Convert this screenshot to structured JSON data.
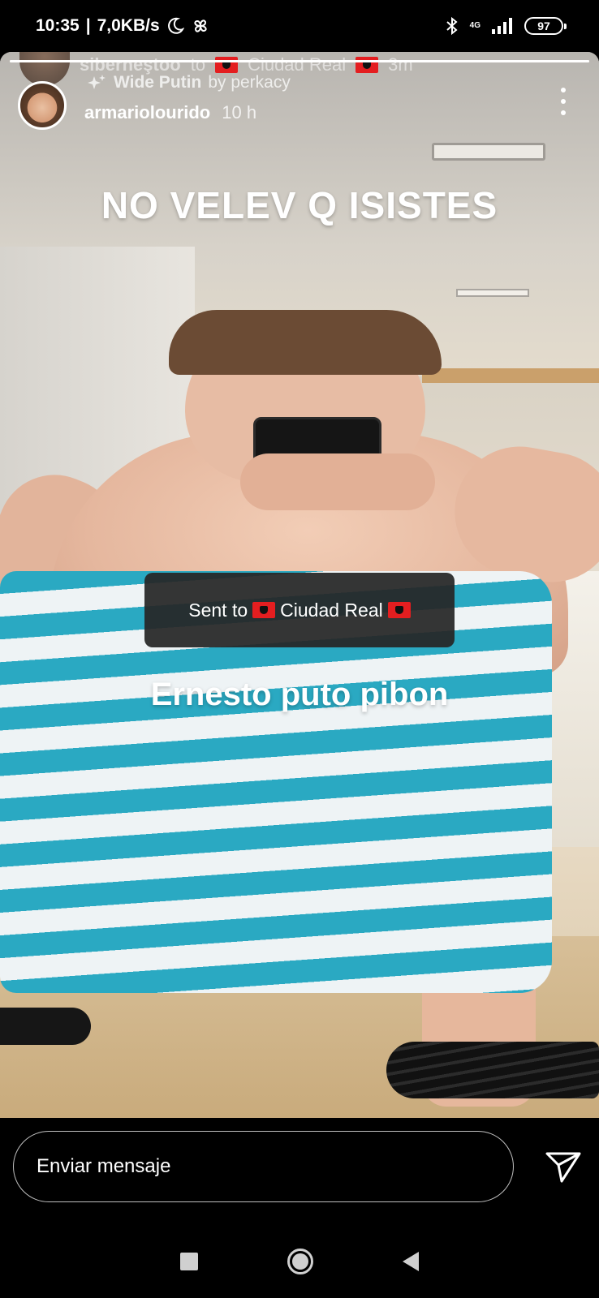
{
  "status_bar": {
    "time": "10:35",
    "network_speed": "7,0KB/s",
    "network_type": "4G",
    "battery": "97",
    "icons": [
      "moon-icon",
      "pinwheel-icon",
      "bluetooth-icon",
      "signal-icon",
      "battery-icon"
    ]
  },
  "story": {
    "progress": 1.0,
    "previous_reply": {
      "username": "siberneştoo",
      "text": "to",
      "target": "Ciudad Real",
      "time": "3m"
    },
    "filter": {
      "name": "Wide Putin",
      "by": "by perkacy"
    },
    "user": {
      "username": "armariolourido",
      "time": "10 h"
    },
    "caption_top": "NO VELEV Q ISISTES",
    "caption_mid": "Ernesto puto pibon",
    "toast": {
      "prefix": "Sent to",
      "target": "Ciudad Real"
    }
  },
  "reply": {
    "placeholder": "Enviar mensaje"
  },
  "colors": {
    "toast_bg": "#262626",
    "flag": "#e41e20",
    "towel_stripe": "#2aa9c2"
  }
}
